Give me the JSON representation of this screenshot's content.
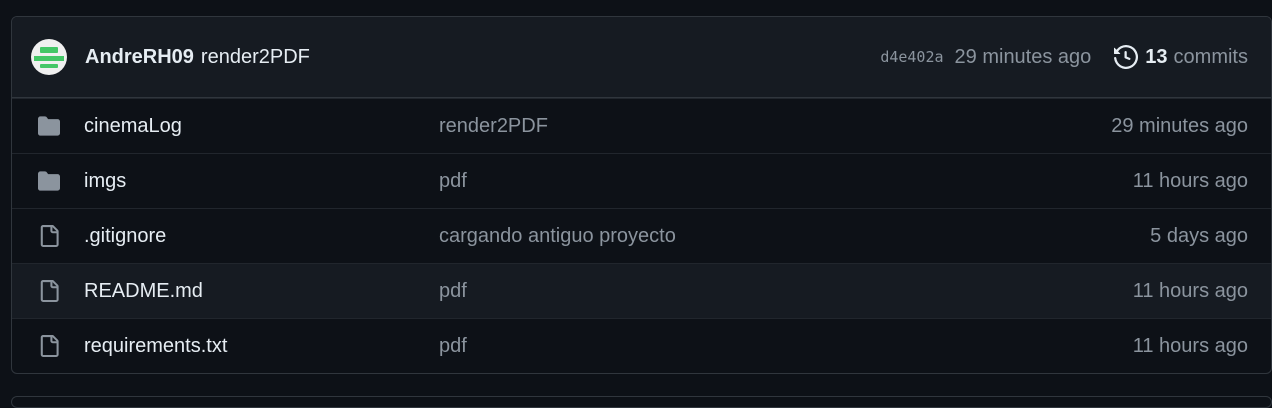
{
  "latest_commit": {
    "author": "AndreRH09",
    "message": "render2PDF",
    "sha": "d4e402a",
    "time": "29 minutes ago",
    "commits_count": "13",
    "commits_label": "commits"
  },
  "files": [
    {
      "name": "cinemaLog",
      "type": "folder",
      "icon": "folder-icon",
      "message": "render2PDF",
      "time": "29 minutes ago"
    },
    {
      "name": "imgs",
      "type": "folder",
      "icon": "folder-icon",
      "message": "pdf",
      "time": "11 hours ago"
    },
    {
      "name": ".gitignore",
      "type": "file",
      "icon": "file-icon",
      "message": "cargando antiguo proyecto",
      "time": "5 days ago"
    },
    {
      "name": "README.md",
      "type": "file",
      "icon": "file-icon",
      "message": "pdf",
      "time": "11 hours ago"
    },
    {
      "name": "requirements.txt",
      "type": "file",
      "icon": "file-icon",
      "message": "pdf",
      "time": "11 hours ago"
    }
  ],
  "colors": {
    "background": "#0d1117",
    "header_bg": "#161b22",
    "border": "#30363d",
    "text": "#e6edf3",
    "muted": "#8b949e",
    "icon": "#8b949e",
    "avatar_accent": "#44c767"
  }
}
